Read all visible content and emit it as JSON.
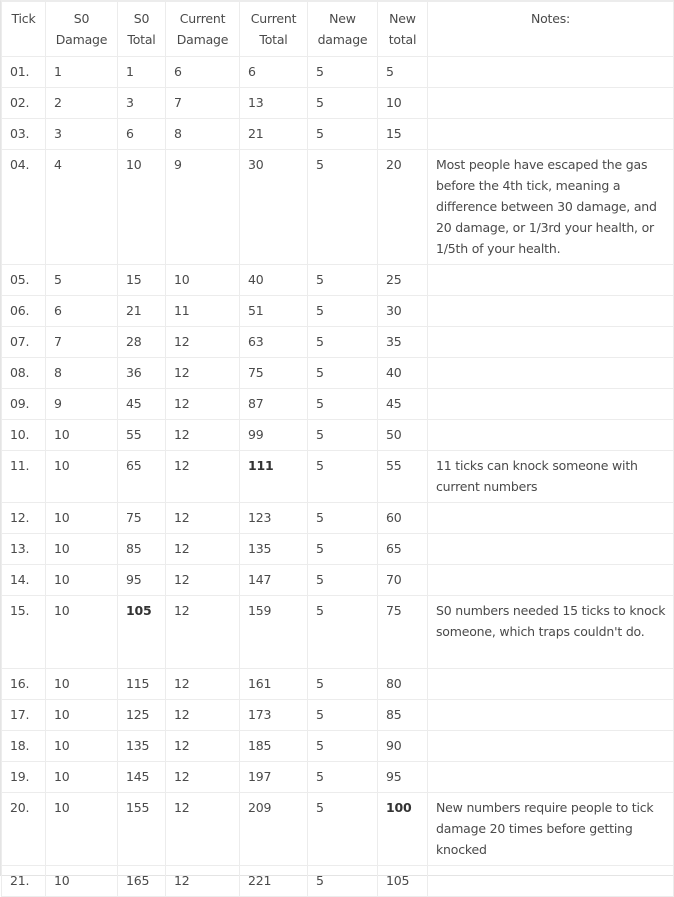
{
  "table": {
    "headers": {
      "tick": "Tick",
      "s0_damage": [
        "S0",
        "Damage"
      ],
      "s0_total": [
        "S0",
        "Total"
      ],
      "current_damage": [
        "Current",
        "Damage"
      ],
      "current_total": [
        "Current",
        "Total"
      ],
      "new_damage": [
        "New",
        "damage"
      ],
      "new_total": [
        "New",
        "total"
      ],
      "notes": "Notes:"
    },
    "rows": [
      {
        "tick": "01.",
        "s0_damage": "1",
        "s0_total": "1",
        "current_damage": "6",
        "current_total": "6",
        "new_damage": "5",
        "new_total": "5",
        "note": "",
        "bold": ""
      },
      {
        "tick": "02.",
        "s0_damage": "2",
        "s0_total": "3",
        "current_damage": "7",
        "current_total": "13",
        "new_damage": "5",
        "new_total": "10",
        "note": "",
        "bold": ""
      },
      {
        "tick": "03.",
        "s0_damage": "3",
        "s0_total": "6",
        "current_damage": "8",
        "current_total": "21",
        "new_damage": "5",
        "new_total": "15",
        "note": "",
        "bold": ""
      },
      {
        "tick": "04.",
        "s0_damage": "4",
        "s0_total": "10",
        "current_damage": "9",
        "current_total": "30",
        "new_damage": "5",
        "new_total": "20",
        "note": "Most people have escaped the gas before the 4th tick, meaning a difference between 30 damage, and 20 damage, or 1/3rd your health, or 1/5th of your health.",
        "bold": ""
      },
      {
        "tick": "05.",
        "s0_damage": "5",
        "s0_total": "15",
        "current_damage": "10",
        "current_total": "40",
        "new_damage": "5",
        "new_total": "25",
        "note": "",
        "bold": ""
      },
      {
        "tick": "06.",
        "s0_damage": "6",
        "s0_total": "21",
        "current_damage": "11",
        "current_total": "51",
        "new_damage": "5",
        "new_total": "30",
        "note": "",
        "bold": ""
      },
      {
        "tick": "07.",
        "s0_damage": "7",
        "s0_total": "28",
        "current_damage": "12",
        "current_total": "63",
        "new_damage": "5",
        "new_total": "35",
        "note": "",
        "bold": ""
      },
      {
        "tick": "08.",
        "s0_damage": "8",
        "s0_total": "36",
        "current_damage": "12",
        "current_total": "75",
        "new_damage": "5",
        "new_total": "40",
        "note": "",
        "bold": ""
      },
      {
        "tick": "09.",
        "s0_damage": "9",
        "s0_total": "45",
        "current_damage": "12",
        "current_total": "87",
        "new_damage": "5",
        "new_total": "45",
        "note": "",
        "bold": ""
      },
      {
        "tick": "10.",
        "s0_damage": "10",
        "s0_total": "55",
        "current_damage": "12",
        "current_total": "99",
        "new_damage": "5",
        "new_total": "50",
        "note": "",
        "bold": ""
      },
      {
        "tick": "11.",
        "s0_damage": "10",
        "s0_total": "65",
        "current_damage": "12",
        "current_total": "111",
        "new_damage": "5",
        "new_total": "55",
        "note": "11 ticks can knock someone with current numbers",
        "bold": "current_total"
      },
      {
        "tick": "12.",
        "s0_damage": "10",
        "s0_total": "75",
        "current_damage": "12",
        "current_total": "123",
        "new_damage": "5",
        "new_total": "60",
        "note": "",
        "bold": ""
      },
      {
        "tick": "13.",
        "s0_damage": "10",
        "s0_total": "85",
        "current_damage": "12",
        "current_total": "135",
        "new_damage": "5",
        "new_total": "65",
        "note": "",
        "bold": ""
      },
      {
        "tick": "14.",
        "s0_damage": "10",
        "s0_total": "95",
        "current_damage": "12",
        "current_total": "147",
        "new_damage": "5",
        "new_total": "70",
        "note": "",
        "bold": ""
      },
      {
        "tick": "15.",
        "s0_damage": "10",
        "s0_total": "105",
        "current_damage": "12",
        "current_total": "159",
        "new_damage": "5",
        "new_total": "75",
        "note": "S0 numbers needed 15 ticks to knock someone, which traps couldn't do.",
        "bold": "s0_total"
      },
      {
        "tick": "16.",
        "s0_damage": "10",
        "s0_total": "115",
        "current_damage": "12",
        "current_total": "161",
        "new_damage": "5",
        "new_total": "80",
        "note": "",
        "bold": ""
      },
      {
        "tick": "17.",
        "s0_damage": "10",
        "s0_total": "125",
        "current_damage": "12",
        "current_total": "173",
        "new_damage": "5",
        "new_total": "85",
        "note": "",
        "bold": ""
      },
      {
        "tick": "18.",
        "s0_damage": "10",
        "s0_total": "135",
        "current_damage": "12",
        "current_total": "185",
        "new_damage": "5",
        "new_total": "90",
        "note": "",
        "bold": ""
      },
      {
        "tick": "19.",
        "s0_damage": "10",
        "s0_total": "145",
        "current_damage": "12",
        "current_total": "197",
        "new_damage": "5",
        "new_total": "95",
        "note": "",
        "bold": ""
      },
      {
        "tick": "20.",
        "s0_damage": "10",
        "s0_total": "155",
        "current_damage": "12",
        "current_total": "209",
        "new_damage": "5",
        "new_total": "100",
        "note": "New numbers require people to tick damage 20 times before getting knocked",
        "bold": "new_total"
      },
      {
        "tick": "21.",
        "s0_damage": "10",
        "s0_total": "165",
        "current_damage": "12",
        "current_total": "221",
        "new_damage": "5",
        "new_total": "105",
        "note": "",
        "bold": ""
      }
    ]
  }
}
